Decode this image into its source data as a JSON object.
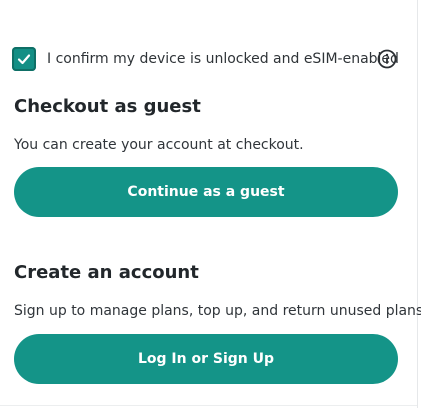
{
  "confirm": {
    "checked": true,
    "label": "I confirm my device is unlocked and eSIM-enabled",
    "info_icon": "info-circle-icon",
    "check_icon": "checkmark-icon"
  },
  "guest": {
    "title": "Checkout as guest",
    "description": "You can create your account at checkout.",
    "button_label": "Continue as a guest"
  },
  "account": {
    "title": "Create an account",
    "description": "Sign up to manage plans, top up, and return unused plans.",
    "button_label": "Log In or Sign Up"
  },
  "colors": {
    "accent": "#149488",
    "checkbox_fill": "#138f85",
    "text": "#2b2f33",
    "button_text": "#ffffff"
  }
}
